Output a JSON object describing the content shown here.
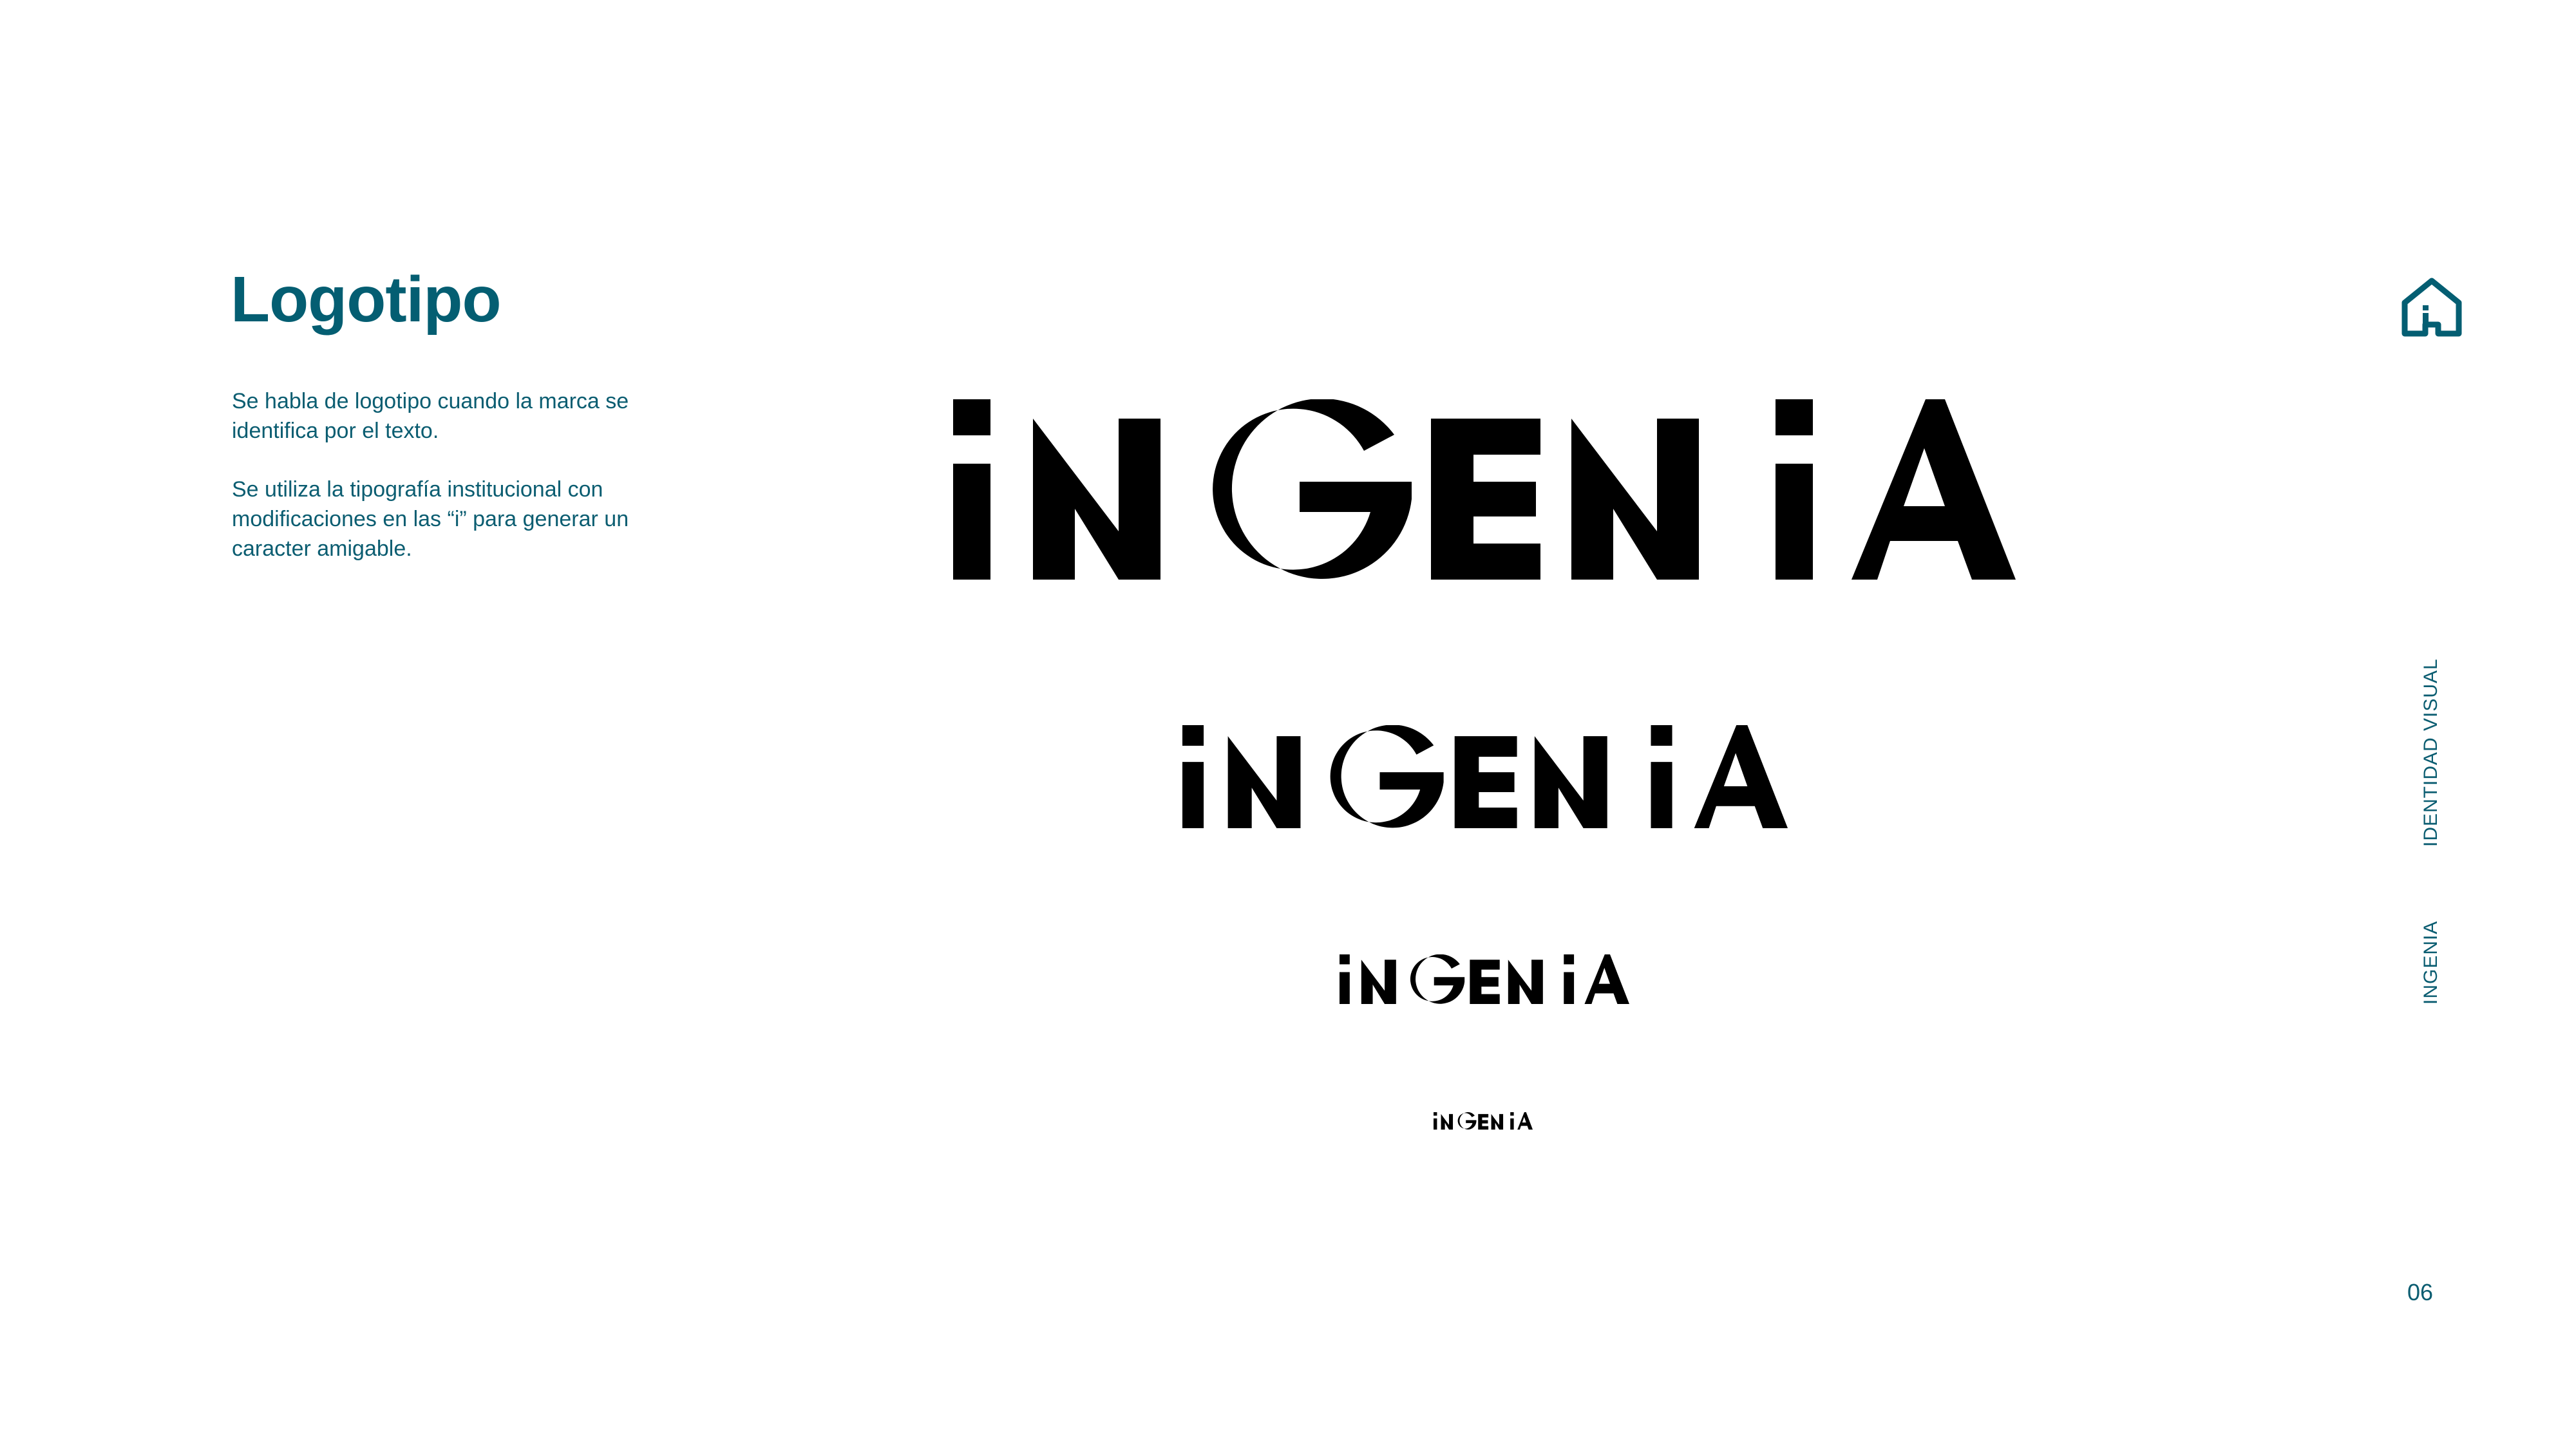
{
  "heading": "Logotipo",
  "description": [
    "Se habla de logotipo cuando la marca se identifica por el texto.",
    "Se utiliza la tipografía institucional con modificaciones en las “i” para generar un caracter amigable."
  ],
  "logo": {
    "wordmark": "iNGENiA",
    "colors": {
      "primary": "#045e72",
      "accent": "#f58a0b"
    }
  },
  "side_nav": {
    "section": "IDENTIDAD VISUAL",
    "brand": "INGENIA",
    "icon": "home-i-icon"
  },
  "page_number": "06"
}
